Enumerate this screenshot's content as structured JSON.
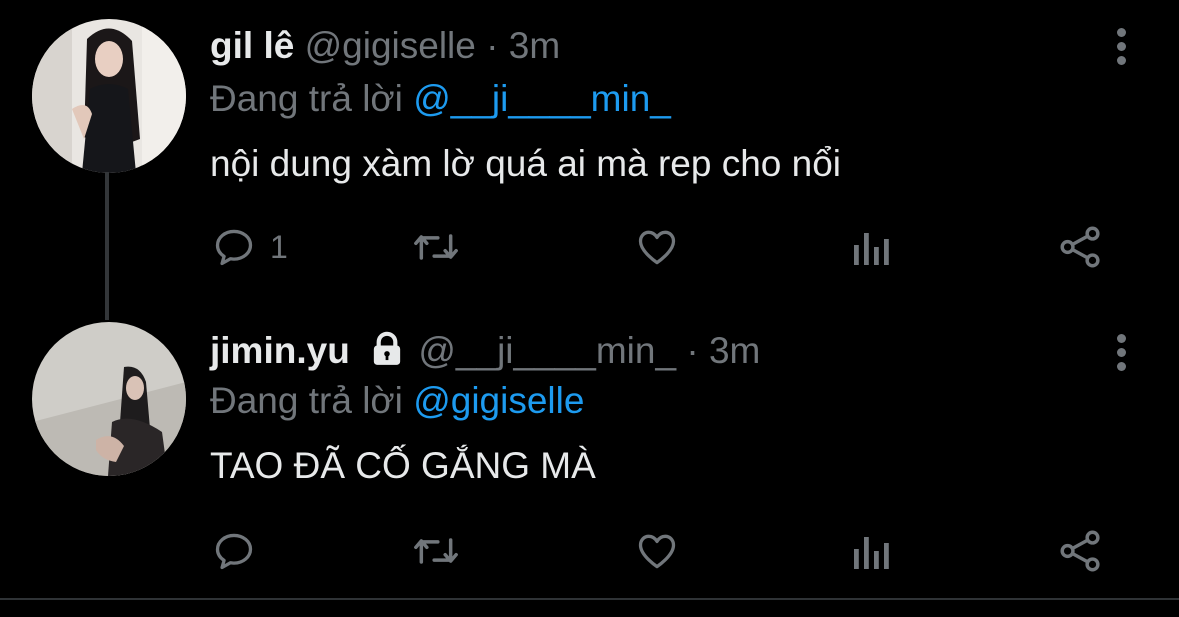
{
  "tweets": [
    {
      "name": "gil lê",
      "handle": "@gigiselle",
      "separator": "·",
      "time": "3m",
      "reply_prefix": "Đang trả lời",
      "reply_to": "@__ji____min_",
      "text": "nội dung xàm lờ quá ai mà rep cho nổi",
      "reply_count": "1",
      "locked": false
    },
    {
      "name": "jimin.yu",
      "handle": "@__ji____min_",
      "separator": "·",
      "time": "3m",
      "reply_prefix": "Đang trả lời",
      "reply_to": "@gigiselle",
      "text": "TAO ĐÃ CỐ GẮNG MÀ",
      "reply_count": "",
      "locked": true
    }
  ],
  "icons": {
    "reply": "speech-bubble-icon",
    "retweet": "retweet-icon",
    "like": "heart-icon",
    "stats": "bar-chart-icon",
    "share": "share-icon",
    "more": "vertical-dots-icon",
    "lock": "lock-icon"
  },
  "colors": {
    "background": "#000000",
    "text": "#e7e9ea",
    "secondary": "#71767b",
    "mention": "#1d9bf0"
  }
}
